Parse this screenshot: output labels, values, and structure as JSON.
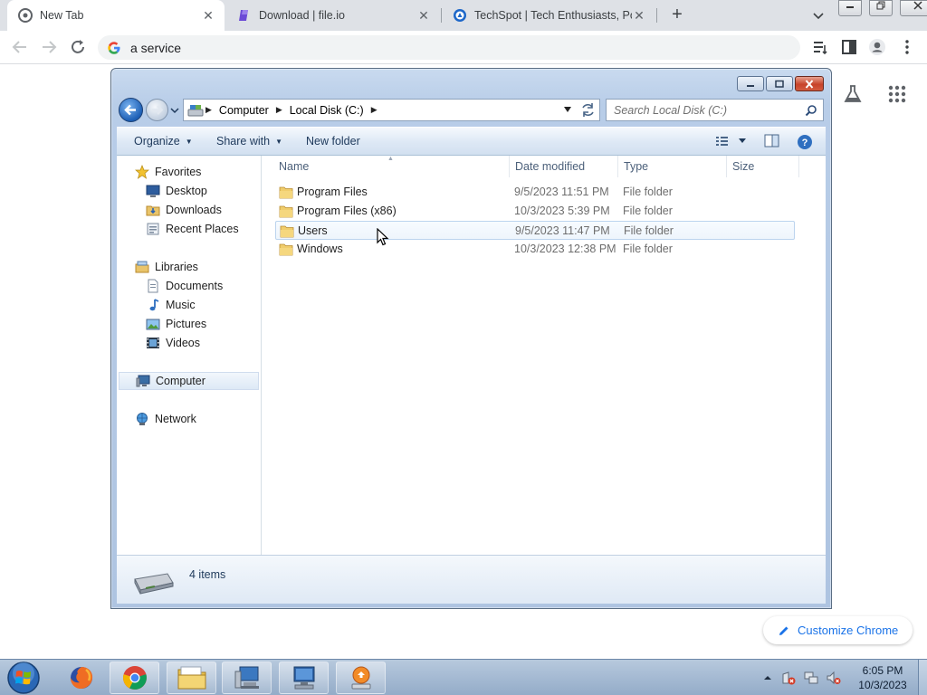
{
  "browser": {
    "tabs": [
      {
        "title": "New Tab",
        "active": true,
        "close": "✕"
      },
      {
        "title": "Download | file.io",
        "active": false,
        "close": "✕"
      },
      {
        "title": "TechSpot | Tech Enthusiasts, Power Users, Gamers",
        "active": false,
        "close": "✕"
      }
    ],
    "new_tab_glyph": "+",
    "address": "a service",
    "customize_label": "Customize Chrome"
  },
  "explorer": {
    "breadcrumbs": [
      "Computer",
      "Local Disk (C:)"
    ],
    "search_placeholder": "Search Local Disk (C:)",
    "commands": {
      "organize": "Organize",
      "share": "Share with",
      "new_folder": "New folder"
    },
    "nav": {
      "favorites": "Favorites",
      "favorites_items": [
        "Desktop",
        "Downloads",
        "Recent Places"
      ],
      "libraries": "Libraries",
      "libraries_items": [
        "Documents",
        "Music",
        "Pictures",
        "Videos"
      ],
      "computer": "Computer",
      "network": "Network"
    },
    "columns": {
      "name": "Name",
      "date": "Date modified",
      "type": "Type",
      "size": "Size"
    },
    "files": [
      {
        "name": "Program Files",
        "date": "9/5/2023 11:51 PM",
        "type": "File folder"
      },
      {
        "name": "Program Files (x86)",
        "date": "10/3/2023 5:39 PM",
        "type": "File folder"
      },
      {
        "name": "Users",
        "date": "9/5/2023 11:47 PM",
        "type": "File folder"
      },
      {
        "name": "Windows",
        "date": "10/3/2023 12:38 PM",
        "type": "File folder"
      }
    ],
    "status": "4 items"
  },
  "taskbar": {
    "time": "6:05 PM",
    "date": "10/3/2023"
  },
  "colors": {
    "chrome_tabstrip": "#dee1e6",
    "chrome_accent": "#1a73e8",
    "explorer_frame": "#b8cde8",
    "taskbar": "#a5bad3"
  }
}
